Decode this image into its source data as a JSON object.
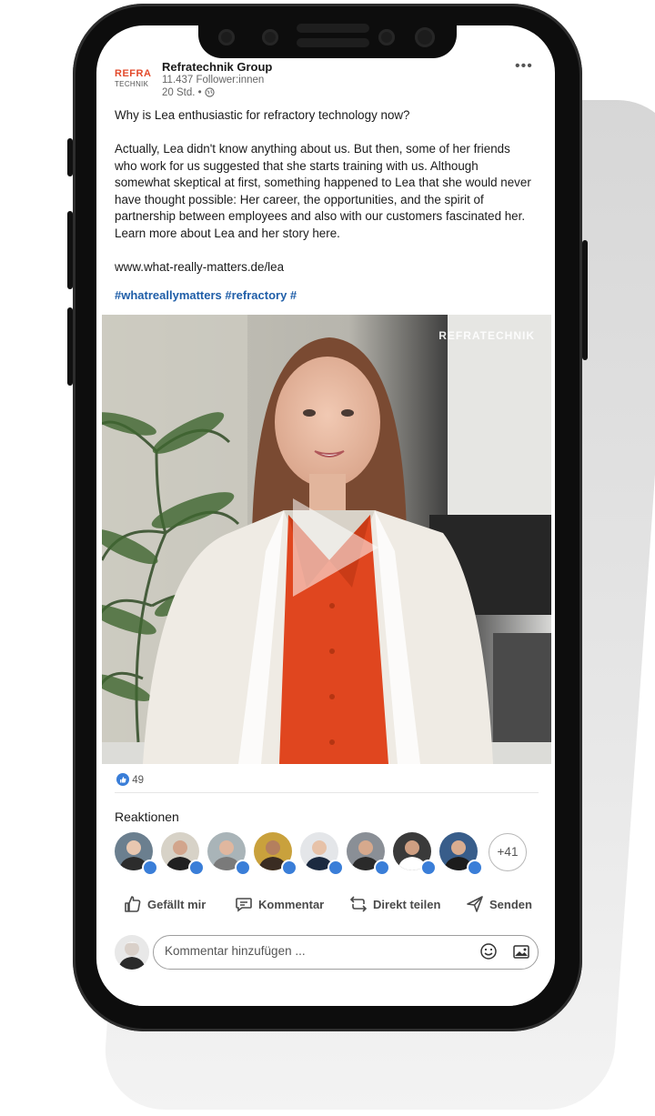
{
  "post": {
    "company": "Refratechnik Group",
    "followers": "11.437 Follower:innen",
    "time": "20 Std. •",
    "logo_line1": "REFRA",
    "logo_line2": "TECHNIK",
    "menu": "•••",
    "question": "Why is Lea enthusiastic for refractory technology now?",
    "body": "Actually, Lea didn't know anything about us. But then, some of her friends who work for us suggested that she starts training with us. Although somewhat skeptical at first, something happened to Lea that she would never have thought possible: Her career, the opportunities, and the spirit of partnership between employees and also with our customers fascinated her. Learn more about Lea and her story here.",
    "link": "www.what-really-matters.de/lea",
    "hashtags": "#whatreallymatters #refractory #"
  },
  "video": {
    "watermark": "REFRATECHNIK",
    "play_icon": "play-icon"
  },
  "reactions": {
    "count": "49",
    "title": "Reaktionen",
    "more": "+41",
    "avatar_count": 8
  },
  "actions": {
    "like": "Gefällt mir",
    "comment": "Kommentar",
    "share": "Direkt teilen",
    "send": "Senden"
  },
  "comment_box": {
    "placeholder": "Kommentar hinzufügen ..."
  },
  "colors": {
    "accent_blue": "#1f5ea8",
    "brand_red": "#e34a2b",
    "shirt": "#e0461f"
  }
}
